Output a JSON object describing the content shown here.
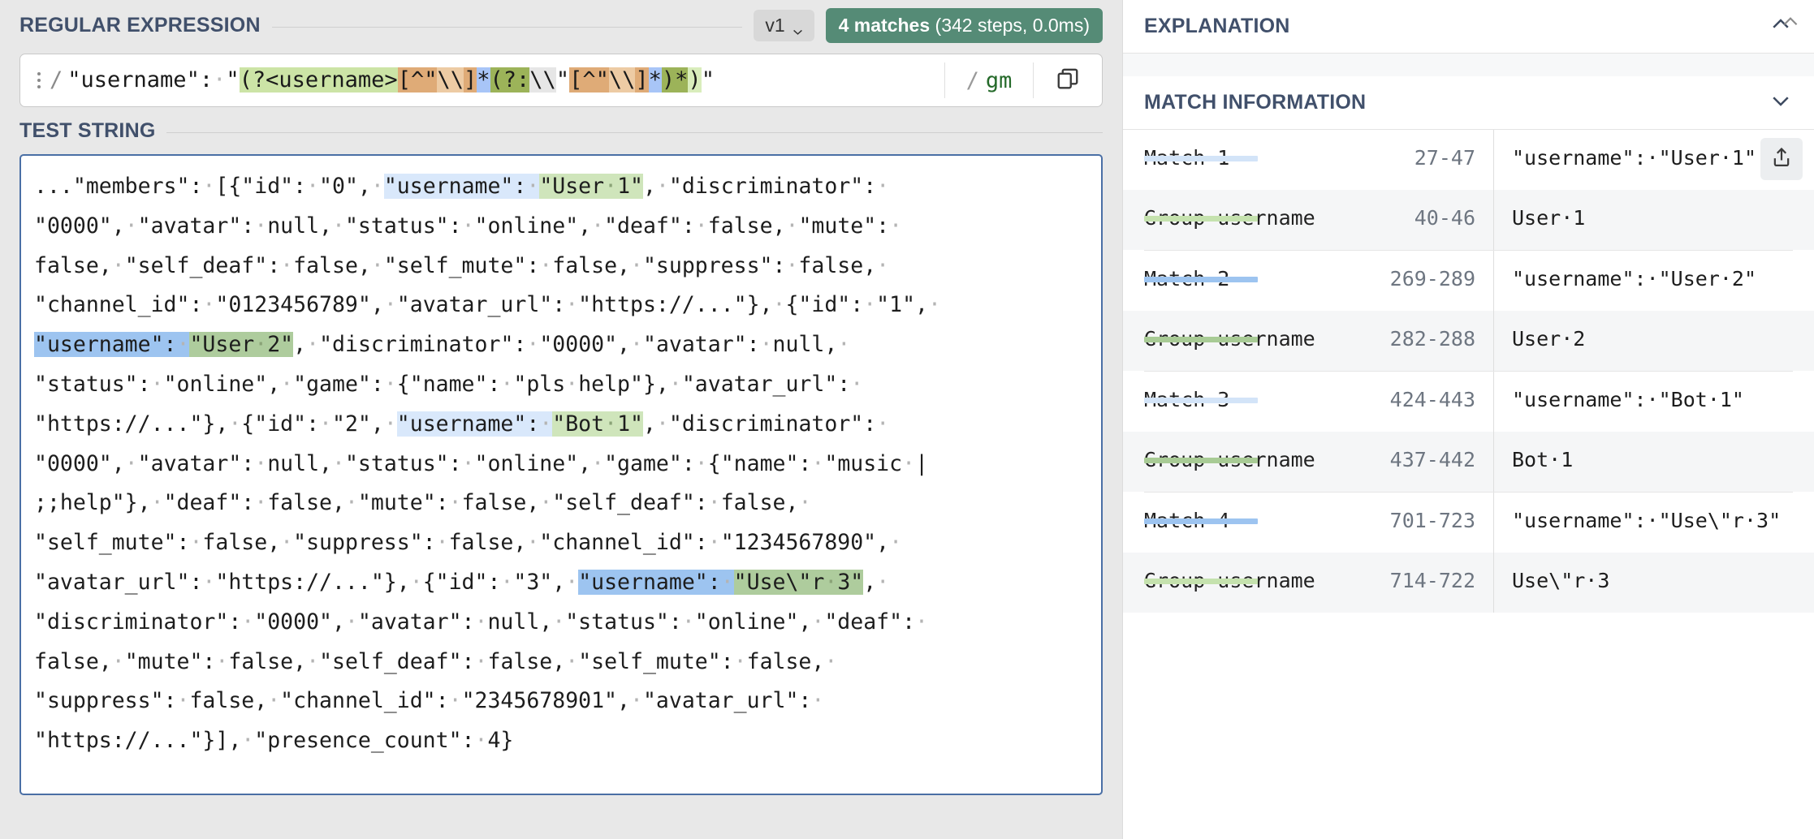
{
  "left": {
    "regex_section_title": "REGULAR EXPRESSION",
    "version_label": "v1",
    "match_badge": {
      "count_text": "4 matches",
      "stats_text": " (342 steps, 0.0ms)"
    },
    "regex": {
      "delimiter": "/",
      "full_pattern": "\"username\": \"(?<username>[^\"\\\\]*(?:\\\\\"[^\"\\\\]*)*)\"",
      "tokens": [
        {
          "text": "\"username\":",
          "style": "plain"
        },
        {
          "text": "·",
          "style": "space-dot"
        },
        {
          "text": "\"",
          "style": "plain"
        },
        {
          "text": "(?<username>",
          "style": "green-light"
        },
        {
          "text": "[^\"",
          "style": "orange"
        },
        {
          "text": "\\\\",
          "style": "orange-light"
        },
        {
          "text": "]",
          "style": "orange"
        },
        {
          "text": "*",
          "style": "blue"
        },
        {
          "text": "(?:",
          "style": "olive"
        },
        {
          "text": "\\\\",
          "style": "gray"
        },
        {
          "text": "\"",
          "style": "plain"
        },
        {
          "text": "[^\"",
          "style": "orange"
        },
        {
          "text": "\\\\",
          "style": "orange-light"
        },
        {
          "text": "]",
          "style": "orange"
        },
        {
          "text": "*",
          "style": "blue"
        },
        {
          "text": ")",
          "style": "olive"
        },
        {
          "text": "*",
          "style": "olive"
        },
        {
          "text": ")",
          "style": "green-light"
        },
        {
          "text": "\"",
          "style": "plain"
        }
      ],
      "flag_slash": "/",
      "flags": "gm",
      "copy_icon": "copy-icon",
      "kebab_icon": "kebab-menu-icon"
    },
    "test_section_title": "TEST STRING",
    "test_string_lines": [
      "...\"members\":·[{\"id\":·\"0\",·\"username\":·\"User·1\",·\"discriminator\":·",
      "\"0000\",·\"avatar\":·null,·\"status\":·\"online\",·\"deaf\":·false,·\"mute\":·",
      "false,·\"self_deaf\":·false,·\"self_mute\":·false,·\"suppress\":·false,·",
      "\"channel_id\":·\"0123456789\",·\"avatar_url\":·\"https://...\"},·{\"id\":·\"1\",·",
      "\"username\":·\"User·2\",·\"discriminator\":·\"0000\",·\"avatar\":·null,·",
      "\"status\":·\"online\",·\"game\":·{\"name\":·\"pls·help\"},·\"avatar_url\":·",
      "\"https://...\"},·{\"id\":·\"2\",·\"username\":·\"Bot·1\",·\"discriminator\":·",
      "\"0000\",·\"avatar\":·null,·\"status\":·\"online\",·\"game\":·{\"name\":·\"music·|",
      ";;help\"},·\"deaf\":·false,·\"mute\":·false,·\"self_deaf\":·false,·",
      "\"self_mute\":·false,·\"suppress\":·false,·\"channel_id\":·\"1234567890\",·",
      "\"avatar_url\":·\"https://...\"},·{\"id\":·\"3\",·\"username\":·\"Use\\\"r·3\",·",
      "\"discriminator\":·\"0000\",·\"avatar\":·null,·\"status\":·\"online\",·\"deaf\":·",
      "false,·\"mute\":·false,·\"self_deaf\":·false,·\"self_mute\":·false,·",
      "\"suppress\":·false,·\"channel_id\":·\"2345678901\",·\"avatar_url\":·",
      "\"https://...\"}],·\"presence_count\":·4}"
    ]
  },
  "right": {
    "explanation": {
      "title": "EXPLANATION",
      "toggle_icon": "chevron-up-icon"
    },
    "match_information": {
      "title": "MATCH INFORMATION",
      "toggle_icon": "chevron-down-icon",
      "share_icon": "share-icon"
    },
    "matches": [
      {
        "match_label": "Match 1",
        "match_range": "27-47",
        "match_value": "\"username\":·\"User·1\"",
        "match_bar": "bar-m-dim",
        "group_label": "Group username",
        "group_range": "40-46",
        "group_value": "User·1",
        "group_bar": "bar-g-dim"
      },
      {
        "match_label": "Match 2",
        "match_range": "269-289",
        "match_value": "\"username\":·\"User·2\"",
        "match_bar": "bar-m-strong",
        "group_label": "Group username",
        "group_range": "282-288",
        "group_value": "User·2",
        "group_bar": "bar-g-strong"
      },
      {
        "match_label": "Match 3",
        "match_range": "424-443",
        "match_value": "\"username\":·\"Bot·1\"",
        "match_bar": "bar-m-dim",
        "group_label": "Group username",
        "group_range": "437-442",
        "group_value": "Bot·1",
        "group_bar": "bar-g-strong"
      },
      {
        "match_label": "Match 4",
        "match_range": "701-723",
        "match_value": "\"username\":·\"Use\\\"r·3\"",
        "match_bar": "bar-m-strong",
        "group_label": "Group username",
        "group_range": "714-722",
        "group_value": "Use\\\"r·3",
        "group_bar": "bar-g-dim"
      }
    ]
  },
  "colors": {
    "accent_heading": "#41506b",
    "match_badge_bg": "#558b76",
    "match_highlight": "#d9e8fb",
    "match_highlight_active": "#9dc4f0",
    "group_highlight": "#cfe5bb",
    "group_highlight_active": "#aecc9d",
    "flags_text": "#256a2a",
    "test_area_border": "#4a6fa5"
  }
}
